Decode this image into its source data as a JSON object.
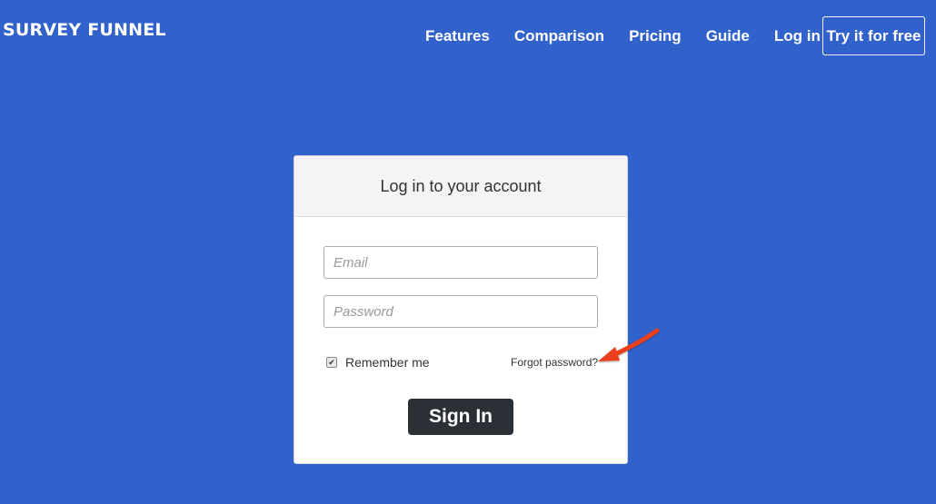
{
  "brand": {
    "logo_text": "SURVEY FUNNEL"
  },
  "nav": {
    "items": [
      {
        "label": "Features"
      },
      {
        "label": "Comparison"
      },
      {
        "label": "Pricing"
      },
      {
        "label": "Guide"
      },
      {
        "label": "Log in"
      }
    ],
    "cta_label": "Try it for free"
  },
  "login": {
    "title": "Log in to your account",
    "email_placeholder": "Email",
    "password_placeholder": "Password",
    "remember_label": "Remember me",
    "remember_checked": true,
    "forgot_label": "Forgot password?",
    "submit_label": "Sign In"
  },
  "annotation": {
    "icon": "arrow-annotation-icon",
    "color": "#e8401c"
  },
  "colors": {
    "background": "#3162cb",
    "button": "#2b2f36"
  }
}
